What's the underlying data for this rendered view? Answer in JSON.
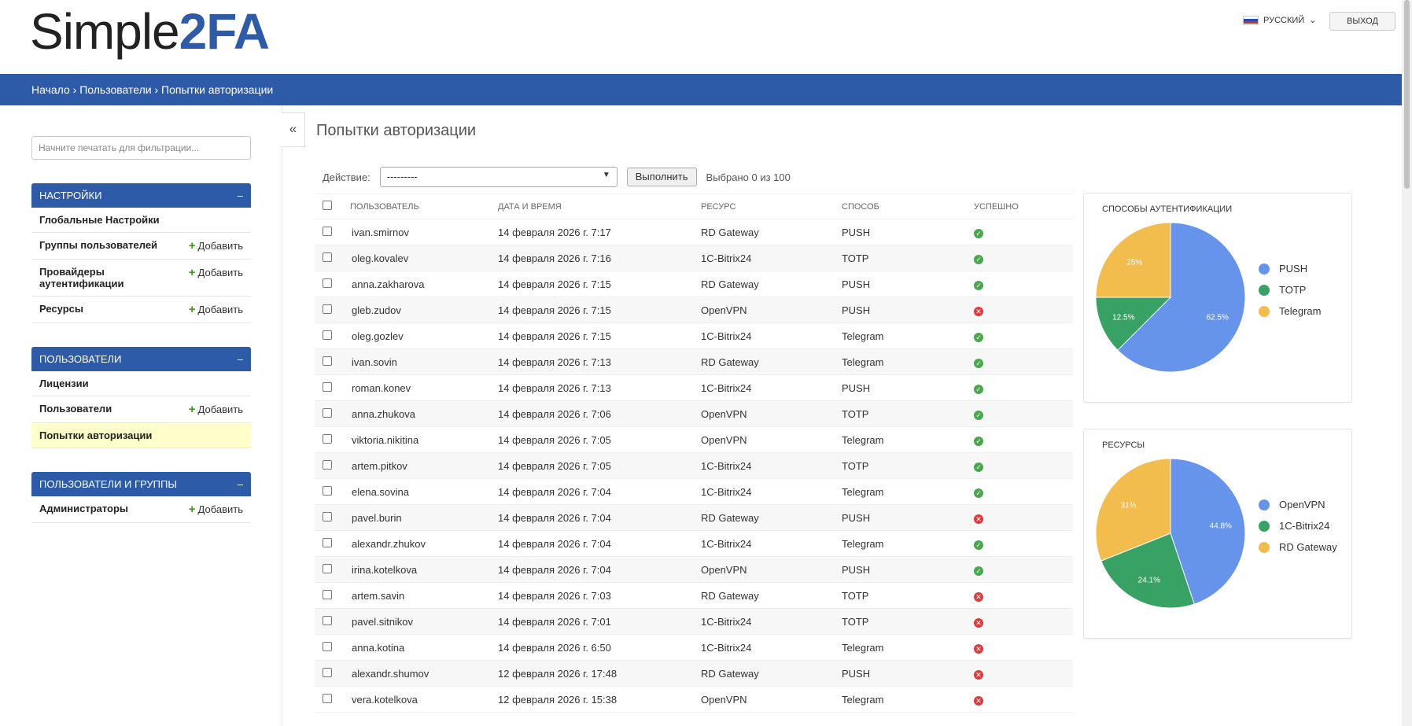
{
  "header": {
    "logo_part1": "Simple",
    "logo_part2": "2FA",
    "language": "РУССКИЙ",
    "logout": "ВЫХОД"
  },
  "breadcrumbs": "Начало › Пользователи › Попытки авторизации",
  "sidebar": {
    "filter_placeholder": "Начните печатать для фильтрации...",
    "modules": [
      {
        "title": "НАСТРОЙКИ",
        "collapse": "–",
        "items": [
          {
            "label": "Глобальные Настройки",
            "add": ""
          },
          {
            "label": "Группы пользователей",
            "add": "Добавить"
          },
          {
            "label": "Провайдеры аутентификации",
            "add": "Добавить"
          },
          {
            "label": "Ресурсы",
            "add": "Добавить"
          }
        ]
      },
      {
        "title": "ПОЛЬЗОВАТЕЛИ",
        "collapse": "–",
        "items": [
          {
            "label": "Лицензии",
            "add": ""
          },
          {
            "label": "Пользователи",
            "add": "Добавить"
          },
          {
            "label": "Попытки авторизации",
            "add": ""
          }
        ]
      },
      {
        "title": "ПОЛЬЗОВАТЕЛИ И ГРУППЫ",
        "collapse": "–",
        "items": [
          {
            "label": "Администраторы",
            "add": "Добавить"
          }
        ]
      }
    ]
  },
  "main": {
    "toggle": "«",
    "title": "Попытки авторизации",
    "action_label": "Действие:",
    "action_value": "---------",
    "go_label": "Выполнить",
    "selected_text": "Выбрано 0 из 100",
    "columns": [
      "ПОЛЬЗОВАТЕЛЬ",
      "ДАТА И ВРЕМЯ",
      "РЕСУРС",
      "СПОСОБ",
      "УСПЕШНО"
    ],
    "rows": [
      [
        "ivan.smirnov",
        "14 февраля 2026 г. 7:17",
        "RD Gateway",
        "PUSH",
        true
      ],
      [
        "oleg.kovalev",
        "14 февраля 2026 г. 7:16",
        "1C-Bitrix24",
        "TOTP",
        true
      ],
      [
        "anna.zakharova",
        "14 февраля 2026 г. 7:15",
        "RD Gateway",
        "PUSH",
        true
      ],
      [
        "gleb.zudov",
        "14 февраля 2026 г. 7:15",
        "OpenVPN",
        "PUSH",
        false
      ],
      [
        "oleg.gozlev",
        "14 февраля 2026 г. 7:15",
        "1C-Bitrix24",
        "Telegram",
        true
      ],
      [
        "ivan.sovin",
        "14 февраля 2026 г. 7:13",
        "RD Gateway",
        "Telegram",
        true
      ],
      [
        "roman.konev",
        "14 февраля 2026 г. 7:13",
        "1C-Bitrix24",
        "PUSH",
        true
      ],
      [
        "anna.zhukova",
        "14 февраля 2026 г. 7:06",
        "OpenVPN",
        "TOTP",
        true
      ],
      [
        "viktoria.nikitina",
        "14 февраля 2026 г. 7:05",
        "OpenVPN",
        "Telegram",
        true
      ],
      [
        "artem.pitkov",
        "14 февраля 2026 г. 7:05",
        "1C-Bitrix24",
        "TOTP",
        true
      ],
      [
        "elena.sovina",
        "14 февраля 2026 г. 7:04",
        "1C-Bitrix24",
        "Telegram",
        true
      ],
      [
        "pavel.burin",
        "14 февраля 2026 г. 7:04",
        "RD Gateway",
        "PUSH",
        false
      ],
      [
        "alexandr.zhukov",
        "14 февраля 2026 г. 7:04",
        "1C-Bitrix24",
        "Telegram",
        true
      ],
      [
        "irina.kotelkova",
        "14 февраля 2026 г. 7:04",
        "OpenVPN",
        "PUSH",
        true
      ],
      [
        "artem.savin",
        "14 февраля 2026 г. 7:03",
        "RD Gateway",
        "TOTP",
        false
      ],
      [
        "pavel.sitnikov",
        "14 февраля 2026 г. 7:01",
        "1C-Bitrix24",
        "TOTP",
        false
      ],
      [
        "anna.kotina",
        "14 февраля 2026 г. 6:50",
        "1C-Bitrix24",
        "Telegram",
        false
      ],
      [
        "alexandr.shumov",
        "12 февраля 2026 г. 17:48",
        "RD Gateway",
        "PUSH",
        false
      ],
      [
        "vera.kotelkova",
        "12 февраля 2026 г. 15:38",
        "OpenVPN",
        "Telegram",
        false
      ]
    ]
  },
  "colors": {
    "blue": "#6694ea",
    "green": "#37a264",
    "yellow": "#f3bd4d",
    "brand": "#2e5ba8"
  },
  "chart_data": [
    {
      "type": "pie",
      "title": "СПОСОБЫ АУТЕНТИФИКАЦИИ",
      "labels": [
        "PUSH",
        "TOTP",
        "Telegram"
      ],
      "values": [
        62.5,
        12.5,
        25
      ],
      "value_labels": [
        "62.5%",
        "12.5%",
        "25%"
      ]
    },
    {
      "type": "pie",
      "title": "РЕСУРСЫ",
      "labels": [
        "OpenVPN",
        "1C-Bitrix24",
        "RD Gateway"
      ],
      "values": [
        44.8,
        24.1,
        31
      ],
      "value_labels": [
        "44.8%",
        "24.1%",
        "31%"
      ]
    }
  ]
}
